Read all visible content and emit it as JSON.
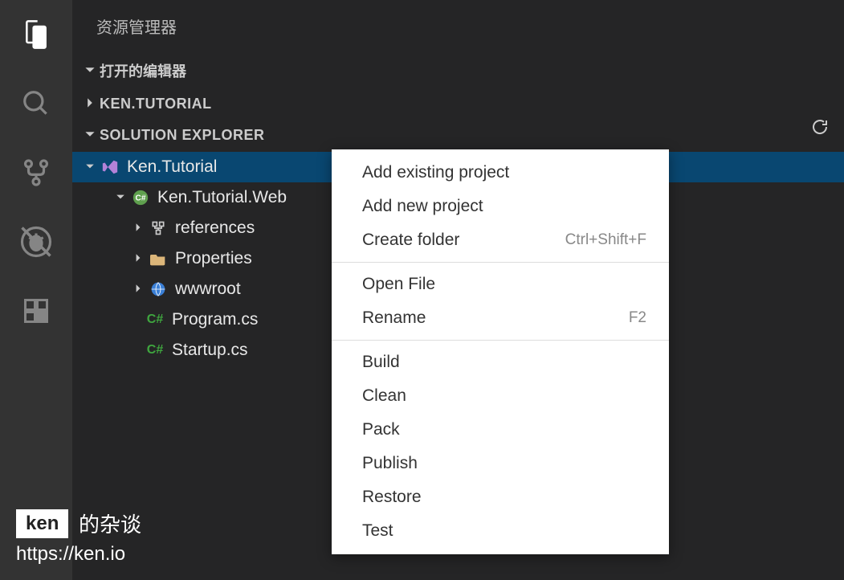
{
  "panel": {
    "title": "资源管理器"
  },
  "sections": {
    "openEditors": "打开的编辑器",
    "kenTutorial": "KEN.TUTORIAL",
    "solutionExplorer": "SOLUTION EXPLORER"
  },
  "tree": {
    "solution": "Ken.Tutorial",
    "project": "Ken.Tutorial.Web",
    "references": "references",
    "properties": "Properties",
    "wwwroot": "wwwroot",
    "program": "Program.cs",
    "startup": "Startup.cs"
  },
  "contextMenu": {
    "addExisting": "Add existing project",
    "addNew": "Add new project",
    "createFolder": "Create folder",
    "createFolderShortcut": "Ctrl+Shift+F",
    "openFile": "Open File",
    "rename": "Rename",
    "renameShortcut": "F2",
    "build": "Build",
    "clean": "Clean",
    "pack": "Pack",
    "publish": "Publish",
    "restore": "Restore",
    "test": "Test"
  },
  "watermark": {
    "badge": "ken",
    "text": "的杂谈",
    "url": "https://ken.io"
  }
}
